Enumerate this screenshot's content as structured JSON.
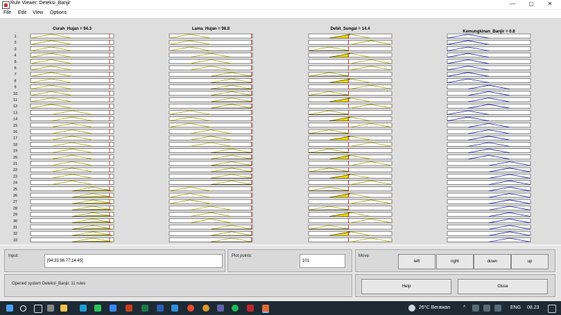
{
  "window": {
    "title": "Rule Viewer: Deteksi_Banjir",
    "minimize_glyph": "—",
    "maximize_glyph": "▢",
    "close_glyph": "✕"
  },
  "menu": [
    "File",
    "Edit",
    "View",
    "Options"
  ],
  "columns": [
    {
      "title": "Curah_Hujan = 94.3",
      "marker_value": 94.3
    },
    {
      "title": "Lama_Hujan = 98.8",
      "marker_value": 98.8
    },
    {
      "title": "Debit_Sungai = 14.4",
      "marker_value": 14.4
    },
    {
      "title": "Kemungkinan_Banjir = 0.8"
    }
  ],
  "rule_numbers": [
    "1",
    "2",
    "3",
    "4",
    "5",
    "6",
    "7",
    "8",
    "9",
    "10",
    "11",
    "12",
    "13",
    "14",
    "15",
    "16",
    "17",
    "18",
    "19",
    "20",
    "21",
    "22",
    "23",
    "24",
    "25",
    "26",
    "27",
    "28",
    "29",
    "30",
    "31",
    "32",
    "33"
  ],
  "rules": [
    [
      0,
      0,
      1,
      0
    ],
    [
      0,
      0,
      2,
      0
    ],
    [
      0,
      0,
      0,
      0
    ],
    [
      0,
      1,
      1,
      0
    ],
    [
      0,
      1,
      2,
      0
    ],
    [
      0,
      1,
      2,
      0
    ],
    [
      0,
      2,
      0,
      0
    ],
    [
      0,
      2,
      1,
      0
    ],
    [
      0,
      2,
      2,
      1
    ],
    [
      0,
      2,
      0,
      1
    ],
    [
      0,
      2,
      1,
      1
    ],
    [
      0,
      2,
      2,
      1
    ],
    [
      1,
      0,
      0,
      0
    ],
    [
      1,
      0,
      1,
      0
    ],
    [
      1,
      0,
      2,
      1
    ],
    [
      1,
      1,
      0,
      1
    ],
    [
      1,
      1,
      1,
      1
    ],
    [
      1,
      1,
      2,
      1
    ],
    [
      1,
      2,
      0,
      1
    ],
    [
      1,
      2,
      1,
      1
    ],
    [
      1,
      2,
      2,
      2
    ],
    [
      1,
      2,
      0,
      2
    ],
    [
      1,
      2,
      1,
      2
    ],
    [
      1,
      2,
      2,
      2
    ],
    [
      2,
      0,
      0,
      2
    ],
    [
      2,
      0,
      1,
      2
    ],
    [
      2,
      0,
      2,
      2
    ],
    [
      2,
      1,
      0,
      2
    ],
    [
      2,
      1,
      1,
      2
    ],
    [
      2,
      1,
      2,
      2
    ],
    [
      2,
      2,
      0,
      2
    ],
    [
      2,
      2,
      1,
      2
    ],
    [
      2,
      2,
      2,
      2
    ]
  ],
  "colors": {
    "input_mf": "#a9a400",
    "output_mf": "#2020b0",
    "fire_fill": "#f5e000",
    "marker": "#d40000",
    "row_border": "#444444"
  },
  "input": {
    "label": "Input:",
    "value": "[94.33;98.77;14.45]"
  },
  "plot_points": {
    "label": "Plot points:",
    "value": "101"
  },
  "move": {
    "label": "Move:",
    "buttons": [
      "left",
      "right",
      "down",
      "up"
    ]
  },
  "status": "Opened system Deteksi_Banjir, 11 rules",
  "help_label": "Help",
  "close_label": "Close",
  "taskbar": {
    "weather": "26°C  Berawan",
    "caret": "^",
    "lang": "ENG",
    "time": "08.23"
  }
}
